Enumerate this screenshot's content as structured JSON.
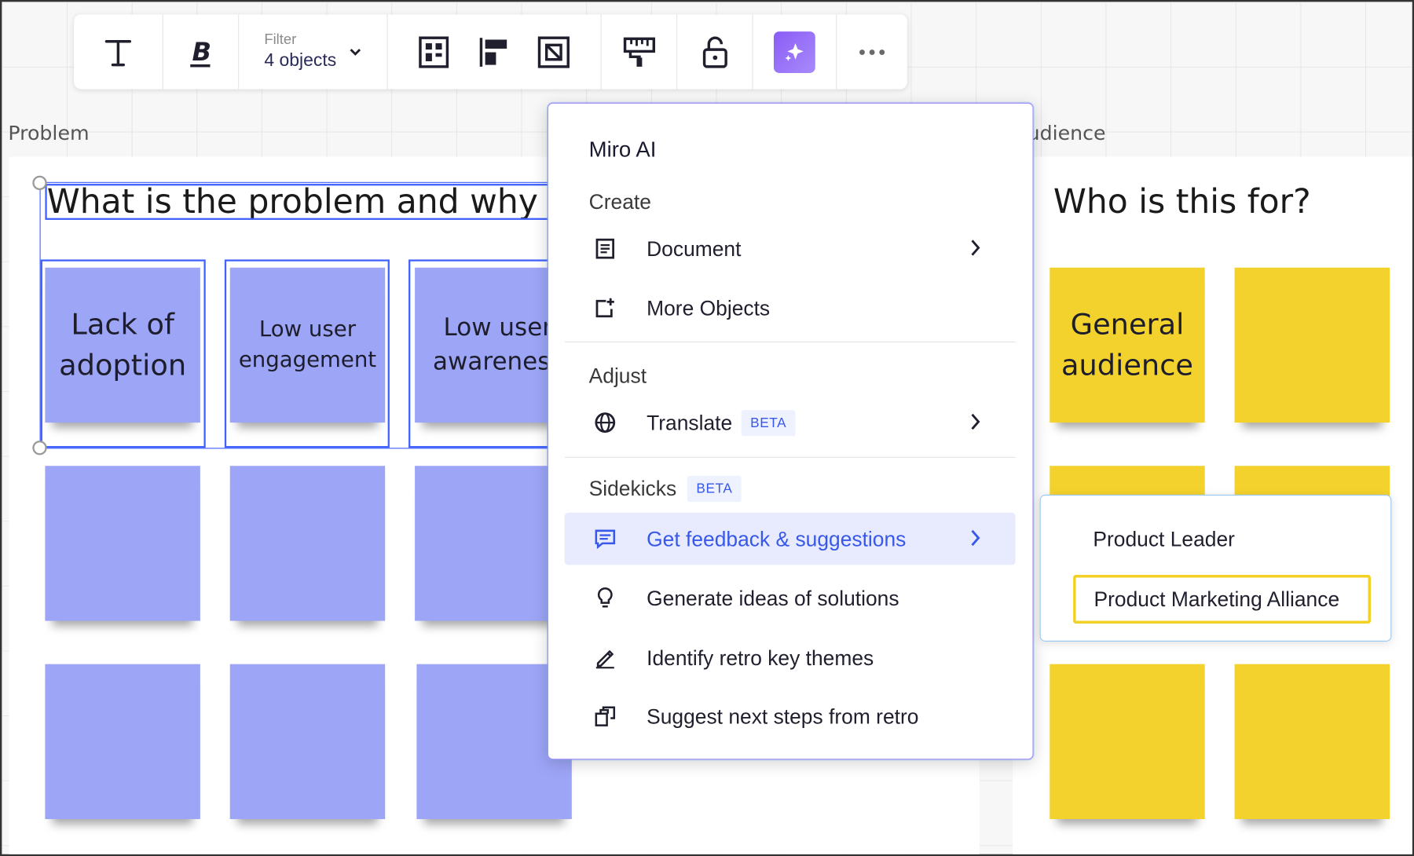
{
  "toolbar": {
    "text_icon": "text-icon",
    "bold_icon": "bold-icon",
    "filter_label": "Filter",
    "filter_value": "4 objects",
    "layout_icons": [
      "grid-layout-icon",
      "align-icon",
      "frame-icon"
    ],
    "format_painter_icon": "paint-roller-icon",
    "lock_icon": "lock-icon",
    "ai_icon": "sparkle-icon",
    "more_icon": "more-icon"
  },
  "board": {
    "left_frame_title": "Problem",
    "left_heading": "What is the problem and why shou",
    "left_notes": [
      "Lack of adoption",
      "Low user engagement",
      "Low user awareness"
    ],
    "right_frame_title": "udience",
    "right_heading": "Who is this for?",
    "right_notes": [
      "General audience"
    ],
    "colors": {
      "purple_note": "#9da5f7",
      "yellow_note": "#f4d22d",
      "selection": "#4262ff"
    }
  },
  "menu": {
    "title": "Miro AI",
    "sections": {
      "create": "Create",
      "adjust": "Adjust",
      "sidekicks": "Sidekicks",
      "sidekicks_badge": "BETA"
    },
    "items": {
      "document": "Document",
      "more_objects": "More Objects",
      "translate": "Translate",
      "translate_badge": "BETA",
      "feedback": "Get feedback & suggestions",
      "ideas": "Generate ideas of solutions",
      "themes": "Identify retro key themes",
      "next_steps": "Suggest next steps from retro"
    }
  },
  "dropdown": {
    "options": [
      "Product Leader",
      "Product Marketing Alliance"
    ],
    "selected": "Product Marketing Alliance"
  }
}
